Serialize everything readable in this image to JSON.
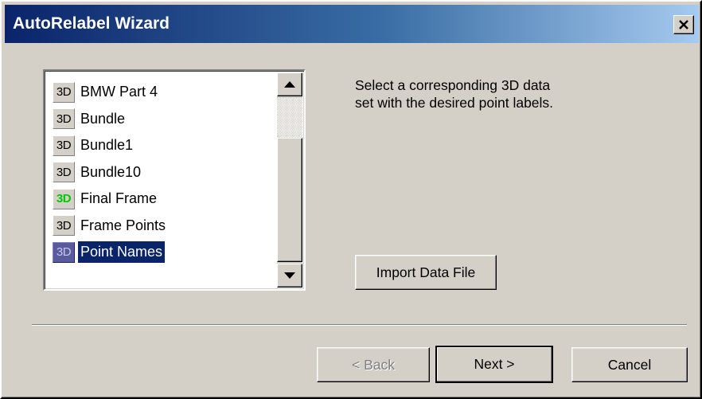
{
  "window": {
    "title": "AutoRelabel Wizard"
  },
  "list": {
    "items": [
      {
        "badge": "3D",
        "label": "BMW Part 4",
        "badge_style": "normal",
        "selected": false
      },
      {
        "badge": "3D",
        "label": "Bundle",
        "badge_style": "normal",
        "selected": false
      },
      {
        "badge": "3D",
        "label": "Bundle1",
        "badge_style": "normal",
        "selected": false
      },
      {
        "badge": "3D",
        "label": "Bundle10",
        "badge_style": "normal",
        "selected": false
      },
      {
        "badge": "3D",
        "label": "Final Frame",
        "badge_style": "green",
        "selected": false
      },
      {
        "badge": "3D",
        "label": "Frame Points",
        "badge_style": "normal",
        "selected": false
      },
      {
        "badge": "3D",
        "label": "Point Names",
        "badge_style": "normal",
        "selected": true
      }
    ]
  },
  "instruction": {
    "line1": "Select a corresponding 3D data",
    "line2": "set with the desired point labels."
  },
  "buttons": {
    "import_label": "Import Data File",
    "back_label": "< Back",
    "next_label": "Next >",
    "cancel_label": "Cancel"
  },
  "colors": {
    "title_gradient_start": "#0a246a",
    "title_gradient_end": "#a6caf0",
    "window_face": "#d4d0c8",
    "selection": "#0a246a",
    "green_badge_text": "#00c800"
  },
  "icons": {
    "close": "close-icon",
    "scroll_up": "arrow-up-icon",
    "scroll_down": "arrow-down-icon"
  }
}
